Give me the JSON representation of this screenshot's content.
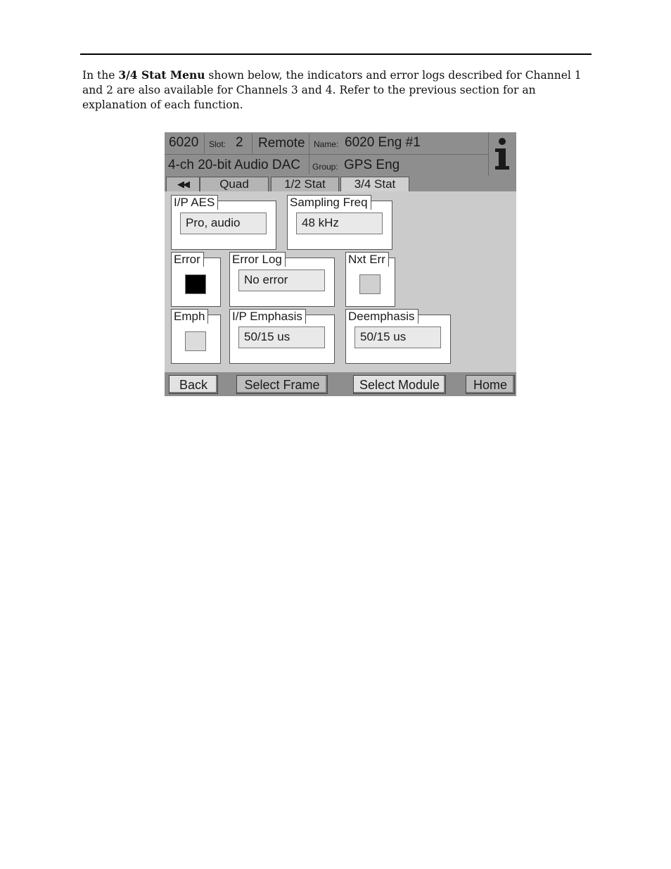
{
  "intro": {
    "before": "In the ",
    "bold": "3/4 Stat Menu",
    "after": " shown below, the indicators and error logs described for Channel 1 and 2 are also available for Channels 3 and 4. Refer to the previous section for an explanation of each function."
  },
  "header": {
    "model": "6020",
    "slot_label": "Slot:",
    "slot_value": "2",
    "mode": "Remote",
    "name_label": "Name:",
    "name_value": "6020 Eng #1",
    "description": "4-ch 20-bit Audio DAC",
    "group_label": "Group:",
    "group_value": "GPS Eng",
    "info_icon": "info-icon"
  },
  "tabs": {
    "back_icon": "double-left-arrow-icon",
    "back_glyph": "◀◀",
    "items": [
      {
        "label": "Quad",
        "active": false
      },
      {
        "label": "1/2 Stat",
        "active": false
      },
      {
        "label": "3/4 Stat",
        "active": true
      }
    ]
  },
  "panel": {
    "ip_aes": {
      "label": "I/P AES",
      "value": "Pro, audio"
    },
    "sampling_freq": {
      "label": "Sampling Freq",
      "value": "48 kHz"
    },
    "error": {
      "label": "Error",
      "color": "#000000"
    },
    "error_log": {
      "label": "Error Log",
      "value": "No error"
    },
    "nxt_err": {
      "label": "Nxt Err",
      "color": "#d0d0d0"
    },
    "emph": {
      "label": "Emph",
      "color": "#dcdcdc"
    },
    "ip_emphasis": {
      "label": "I/P Emphasis",
      "value": "50/15 us"
    },
    "deemphasis": {
      "label": "Deemphasis",
      "value": "50/15 us"
    }
  },
  "footer": {
    "back": "Back",
    "select_frame": "Select Frame",
    "select_module": "Select Module",
    "home": "Home"
  }
}
